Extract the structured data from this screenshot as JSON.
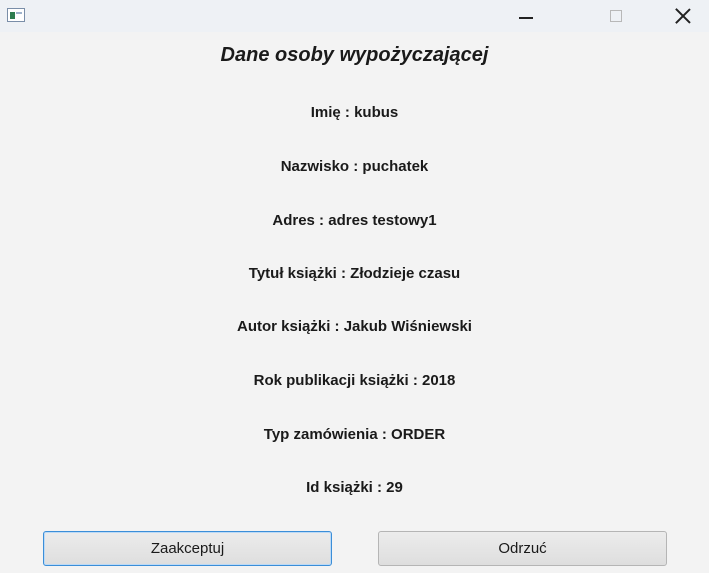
{
  "window": {
    "controls": {
      "minimize_icon": "minimize-icon",
      "maximize_icon": "maximize-icon",
      "close_icon": "close-icon"
    }
  },
  "form": {
    "heading": "Dane osoby wypożyczającej",
    "fields": [
      {
        "label": "Imię",
        "value": "kubus",
        "text": "Imię : kubus"
      },
      {
        "label": "Nazwisko",
        "value": "puchatek",
        "text": "Nazwisko : puchatek"
      },
      {
        "label": "Adres",
        "value": "adres testowy1",
        "text": "Adres : adres testowy1"
      },
      {
        "label": "Tytuł książki",
        "value": "Złodzieje czasu",
        "text": "Tytuł książki : Złodzieje czasu"
      },
      {
        "label": "Autor książki",
        "value": "Jakub Wiśniewski",
        "text": "Autor książki : Jakub Wiśniewski"
      },
      {
        "label": "Rok publikacji książki",
        "value": "2018",
        "text": "Rok publikacji książki : 2018"
      },
      {
        "label": "Typ zamówienia",
        "value": "ORDER",
        "text": "Typ zamówienia : ORDER"
      },
      {
        "label": "Id książki",
        "value": "29",
        "text": "Id książki : 29"
      }
    ]
  },
  "buttons": {
    "accept_label": "Zaakceptuj",
    "reject_label": "Odrzuć"
  },
  "colors": {
    "background": "#f3f3f3",
    "titlebar": "#eef1f5",
    "focus_border": "#3b8ed8"
  }
}
